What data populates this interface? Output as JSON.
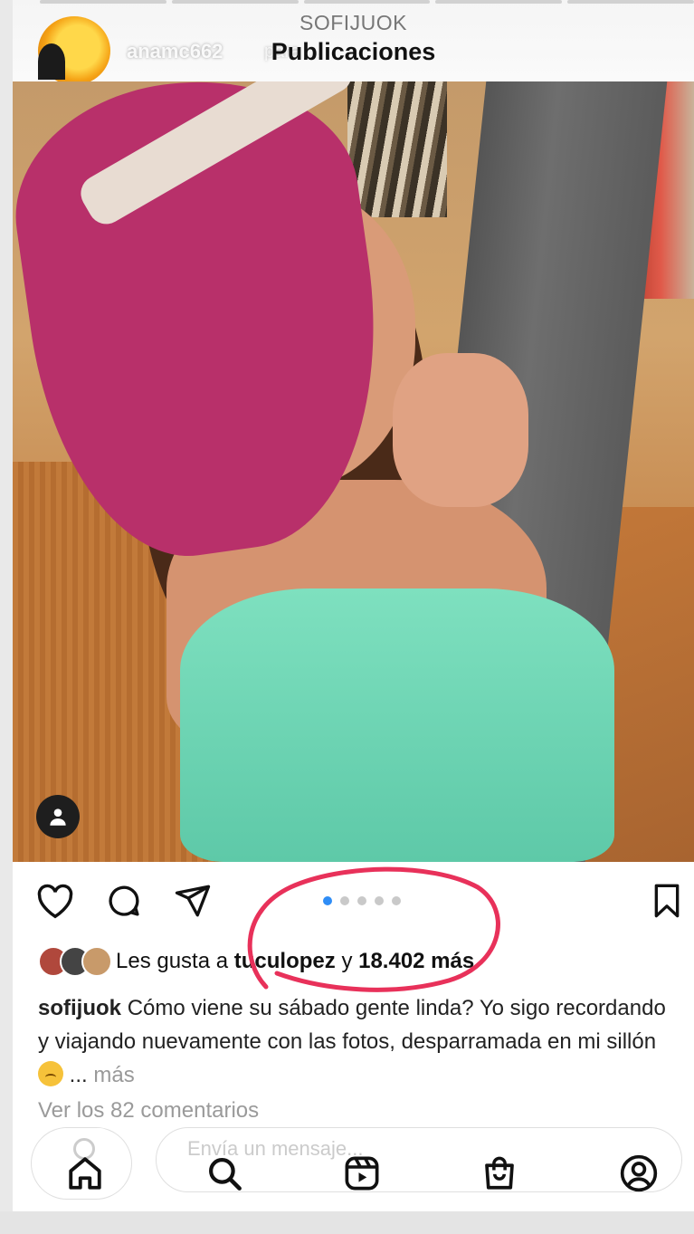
{
  "story": {
    "title": "SOFIJUOK",
    "user": "anamc662",
    "user_sub": "para ...",
    "section": "Publicaciones",
    "progress_bars": 5
  },
  "post": {
    "carousel": {
      "total": 5,
      "active_index": 0
    },
    "likes": {
      "prefix": "Les gusta a",
      "user": "tuculopez",
      "connector": "y",
      "count_text": "18.402 más"
    },
    "caption": {
      "user": "sofijuok",
      "text": "Cómo viene su sábado gente linda? Yo sigo recordando y viajando nuevamente con las fotos, desparramada en mi sillón",
      "ellipsis": "...",
      "more": "más"
    },
    "comments_link": "Ver los 82 comentarios"
  },
  "reply": {
    "placeholder": "Envía un mensaje..."
  },
  "icons": {
    "like": "heart-icon",
    "comment": "comment-icon",
    "share": "send-icon",
    "save": "bookmark-icon",
    "tag": "user-tag-icon",
    "nav": [
      "home-icon",
      "search-icon",
      "reels-icon",
      "shop-icon",
      "profile-icon"
    ]
  },
  "colors": {
    "carousel_active": "#2f8df6",
    "annotation": "#e8315a"
  }
}
